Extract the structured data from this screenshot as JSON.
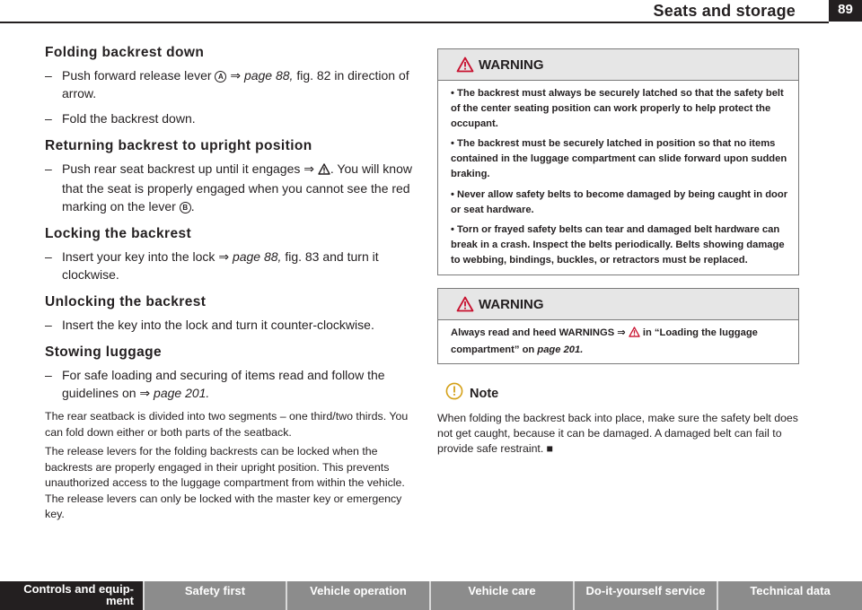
{
  "header": {
    "section_title": "Seats and storage",
    "page_number": "89"
  },
  "left": {
    "h1": "Folding backrest down",
    "s1_pre": "Push forward release lever",
    "s1_lever": "A",
    "s1_arrow": "⇒",
    "s1_ref": "page 88,",
    "s1_post": "fig. 82 in direction of arrow.",
    "s2": "Fold the backrest down.",
    "h2": "Returning backrest to upright position",
    "s3_pre": "Push rear seat backrest up until it engages",
    "s3_arrow": "⇒",
    "s3_post": ". You will know that the seat is properly engaged when you cannot see the red marking on the lever",
    "s3_lever": "B",
    "s3_end": ".",
    "h3": "Locking the backrest",
    "s4_pre": "Insert your key into the lock",
    "s4_arrow": "⇒",
    "s4_ref": "page 88,",
    "s4_post": "fig. 83 and turn it clockwise.",
    "h4": "Unlocking the backrest",
    "s5": "Insert the key into the lock and turn it counter-clockwise.",
    "h5": "Stowing luggage",
    "s6_pre": "For safe loading and securing of items read and follow the guidelines on",
    "s6_arrow": "⇒",
    "s6_ref": "page 201.",
    "p1": "The rear seatback is divided into two segments – one third/two thirds. You can fold down either or both parts of the seatback.",
    "p2": "The release levers for the folding backrests can be locked when the backrests are properly engaged in their upright position. This prevents unauthorized access to the luggage compartment from within the vehicle. The release levers can only be locked with the master key or emergency key."
  },
  "right": {
    "warning1": {
      "title": "WARNING",
      "items": [
        "•  The backrest must always be securely latched so that the safety belt of the center seating position can work properly to help protect the occupant.",
        "•  The backrest must be securely latched in position so that no items contained in the luggage compartment can slide forward upon sudden braking.",
        "•  Never allow safety belts to become damaged by being caught in door or seat hardware.",
        "•  Torn or frayed safety belts can tear and damaged belt hardware can break in a crash. Inspect the belts periodically. Belts showing damage to webbing, bindings, buckles, or retractors must be replaced."
      ]
    },
    "warning2": {
      "title": "WARNING",
      "pre": "Always read and heed WARNINGS",
      "arrow": "⇒",
      "post": " in “Loading the luggage compartment” on",
      "ref": "page 201."
    },
    "note": {
      "title": "Note",
      "body": "When folding the backrest back into place, make sure the safety belt does not get caught, because it can be damaged. A damaged belt can fail to provide safe restraint.",
      "end_mark": "■"
    }
  },
  "footer": {
    "tabs": [
      "Controls and equip-",
      "ment",
      "Safety first",
      "Vehicle operation",
      "Vehicle care",
      "Do-it-yourself service",
      "Technical data"
    ]
  },
  "colors": {
    "text": "#231f20",
    "warning_header_bg": "#e6e6e6",
    "footer_bg": "#d9d9d9",
    "footer_tab": "#8c8c8c"
  }
}
